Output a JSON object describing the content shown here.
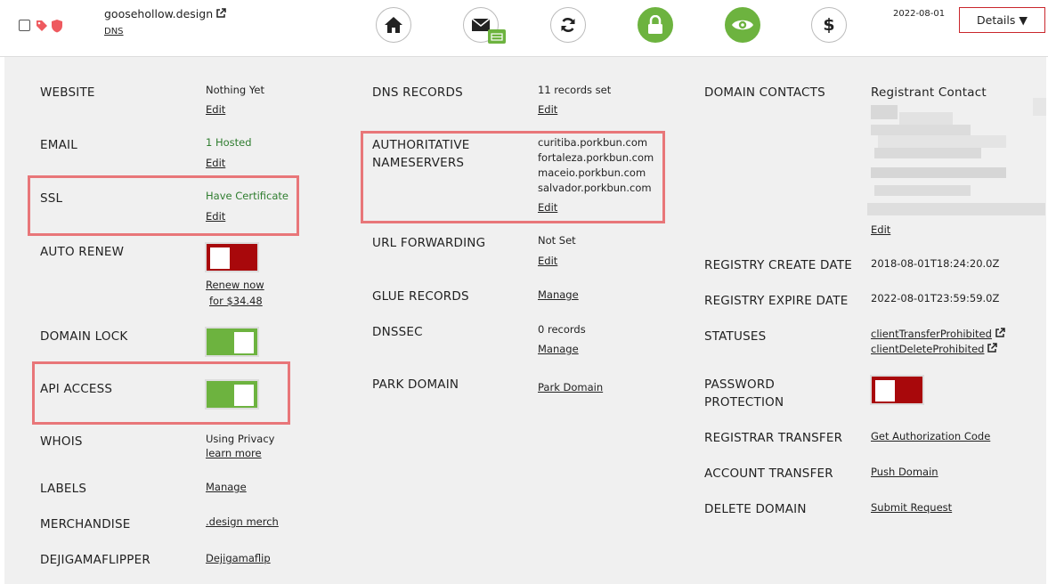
{
  "header": {
    "domain": "goosehollow.design",
    "dns_link": "DNS",
    "expiry_date": "2022-08-01",
    "details_button": "Details ▼",
    "icons": [
      "home-icon",
      "email-icon",
      "refresh-icon",
      "lock-icon",
      "eye-icon",
      "dollar-icon"
    ]
  },
  "col1": {
    "website": {
      "label": "WEBSITE",
      "value": "Nothing Yet",
      "link": "Edit"
    },
    "email": {
      "label": "EMAIL",
      "value": "1 Hosted",
      "link": "Edit"
    },
    "ssl": {
      "label": "SSL",
      "value": "Have Certificate",
      "link": "Edit"
    },
    "auto_renew": {
      "label": "AUTO RENEW",
      "state": "off",
      "link1": "Renew now",
      "link2": "for $34.48"
    },
    "domain_lock": {
      "label": "DOMAIN LOCK",
      "state": "on"
    },
    "api_access": {
      "label": "API ACCESS",
      "state": "on"
    },
    "whois": {
      "label": "WHOIS",
      "value": "Using Privacy",
      "link": "learn more"
    },
    "labels": {
      "label": "LABELS",
      "link": "Manage"
    },
    "merchandise": {
      "label": "MERCHANDISE",
      "link": ".design merch"
    },
    "dejigamaflipper": {
      "label": "DEJIGAMAFLIPPER",
      "link": "Dejigamaflip"
    }
  },
  "col2": {
    "dns_records": {
      "label": "DNS RECORDS",
      "value": "11 records set",
      "link": "Edit"
    },
    "nameservers": {
      "label_line1": "AUTHORITATIVE",
      "label_line2": "NAMESERVERS",
      "servers": [
        "curitiba.porkbun.com",
        "fortaleza.porkbun.com",
        "maceio.porkbun.com",
        "salvador.porkbun.com"
      ],
      "link": "Edit"
    },
    "url_forwarding": {
      "label": "URL FORWARDING",
      "value": "Not Set",
      "link": "Edit"
    },
    "glue_records": {
      "label": "GLUE RECORDS",
      "link": "Manage"
    },
    "dnssec": {
      "label": "DNSSEC",
      "value": "0 records",
      "link": "Manage"
    },
    "park_domain": {
      "label": "PARK DOMAIN",
      "link": "Park Domain"
    }
  },
  "col3": {
    "domain_contacts": {
      "label": "DOMAIN CONTACTS",
      "value": "Registrant Contact",
      "link": "Edit"
    },
    "registry_create": {
      "label": "REGISTRY CREATE DATE",
      "value": "2018-08-01T18:24:20.0Z"
    },
    "registry_expire": {
      "label": "REGISTRY EXPIRE DATE",
      "value": "2022-08-01T23:59:59.0Z"
    },
    "statuses": {
      "label": "STATUSES",
      "items": [
        "clientTransferProhibited",
        "clientDeleteProhibited"
      ]
    },
    "password_protection": {
      "label_line1": "PASSWORD",
      "label_line2": "PROTECTION",
      "state": "off"
    },
    "registrar_transfer": {
      "label": "REGISTRAR TRANSFER",
      "link": "Get Authorization Code"
    },
    "account_transfer": {
      "label": "ACCOUNT TRANSFER",
      "link": "Push Domain"
    },
    "delete_domain": {
      "label": "DELETE DOMAIN",
      "link": "Submit Request"
    }
  },
  "colors": {
    "green": "#6db33f",
    "red": "#a8080b",
    "highlight": "#e87679"
  }
}
